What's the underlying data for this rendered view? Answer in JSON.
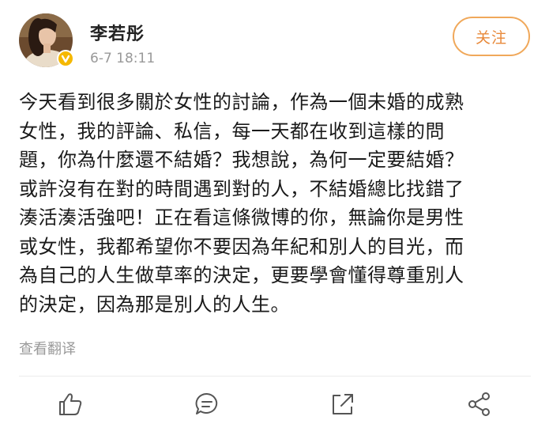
{
  "post": {
    "author": "李若彤",
    "time": "6-7 18:11",
    "follow_label": "关注",
    "lines": [
      "今天看到很多關於女性的討論，作為一個未婚的成熟",
      "女性，我的評論、私信，每一天都在收到這樣的問",
      "題，你為什麼還不結婚？我想說，為何一定要結婚？",
      "或許沒有在對的時間遇到對的人，不結婚總比找錯了",
      "湊活湊活強吧！正在看這條微博的你，無論你是男性",
      "或女性，我都希望你不要因為年紀和別人的目光，而",
      "為自己的人生做草率的決定，更要學會懂得尊重別人",
      "的決定，因為那是別人的人生。"
    ],
    "translate_label": "查看翻译"
  },
  "actions": {
    "like_icon": "thumbs-up-icon",
    "comment_icon": "comment-icon",
    "repost_icon": "repost-icon",
    "share_icon": "share-icon"
  },
  "colors": {
    "accent": "#e8893a",
    "verified": "#f5b800",
    "secondary_text": "#999999",
    "icon": "#555555"
  }
}
